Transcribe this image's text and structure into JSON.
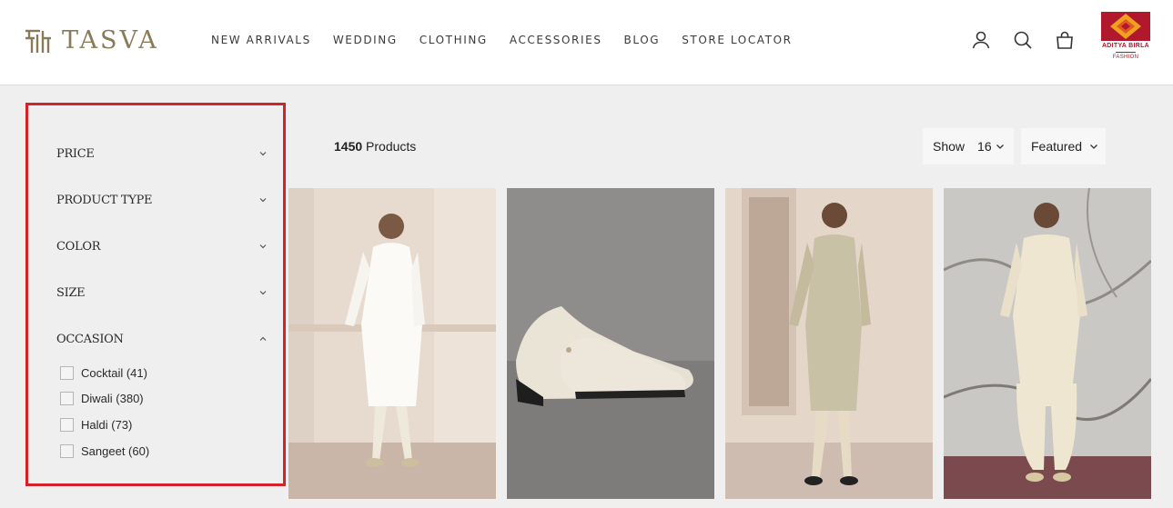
{
  "brand": {
    "name": "TASVA"
  },
  "nav": [
    {
      "label": "NEW ARRIVALS"
    },
    {
      "label": "WEDDING"
    },
    {
      "label": "CLOTHING"
    },
    {
      "label": "ACCESSORIES"
    },
    {
      "label": "BLOG"
    },
    {
      "label": "STORE LOCATOR"
    }
  ],
  "header_icons": [
    "account-icon",
    "search-icon",
    "bag-icon"
  ],
  "partner": {
    "name": "ADITYA BIRLA",
    "sub": "FASHION"
  },
  "filters": [
    {
      "label": "PRICE",
      "expanded": false
    },
    {
      "label": "PRODUCT TYPE",
      "expanded": false
    },
    {
      "label": "COLOR",
      "expanded": false
    },
    {
      "label": "SIZE",
      "expanded": false
    },
    {
      "label": "OCCASION",
      "expanded": true
    }
  ],
  "occasion_options": [
    {
      "label": "Cocktail (41)",
      "checked": false
    },
    {
      "label": "Diwali (380)",
      "checked": false
    },
    {
      "label": "Haldi (73)",
      "checked": false
    },
    {
      "label": "Sangeet (60)",
      "checked": false
    }
  ],
  "results": {
    "count": "1450",
    "label": "Products"
  },
  "show": {
    "label": "Show",
    "value": "16"
  },
  "sort": {
    "value": "Featured"
  },
  "colors": {
    "accent": "#8a7a5a",
    "highlight": "#d3222a",
    "partner": "#b0182e"
  }
}
